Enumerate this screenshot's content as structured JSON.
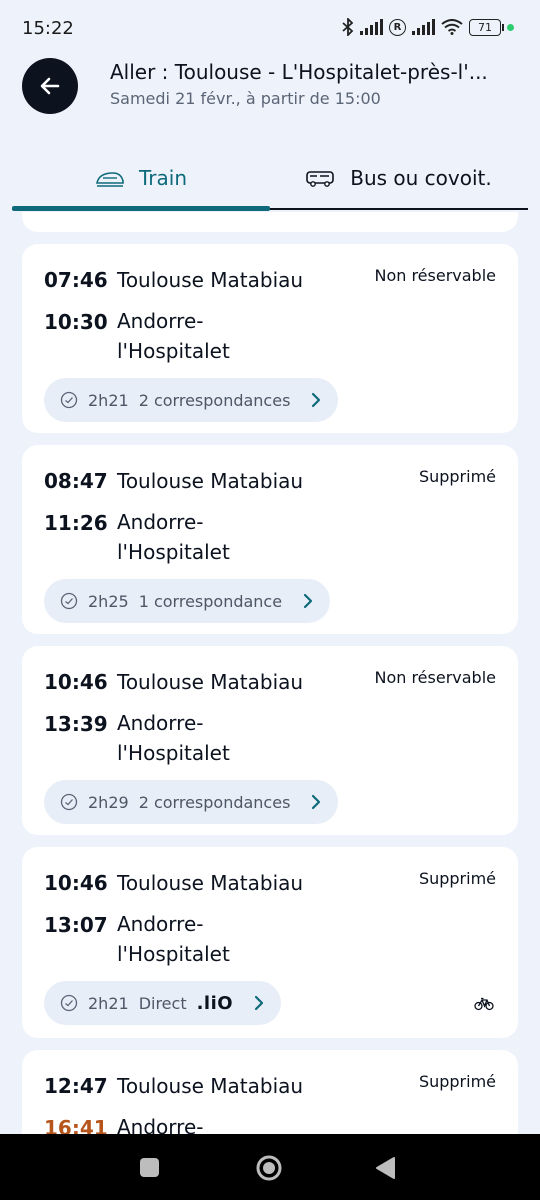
{
  "status_bar": {
    "time": "15:22",
    "battery": "71"
  },
  "header": {
    "title": "Aller : Toulouse - L'Hospitalet-près-l'...",
    "subtitle": "Samedi 21 févr., à partir de 15:00"
  },
  "tabs": [
    {
      "label": "Train",
      "icon": "train-icon",
      "selected": true
    },
    {
      "label": "Bus ou covoit.",
      "icon": "bus-icon",
      "selected": false
    }
  ],
  "colors": {
    "accent": "#0e6a7a",
    "delay": "#b5541b",
    "background": "#eef3fb"
  },
  "journeys": [
    {
      "dep_time": "07:46",
      "dep_station": "Toulouse Matabiau",
      "arr_time": "10:30",
      "arr_station": "Andorre-\nl'Hospitalet",
      "status": "Non réservable",
      "duration": "2h21",
      "connections": "2 correspondances"
    },
    {
      "dep_time": "08:47",
      "dep_station": "Toulouse Matabiau",
      "arr_time": "11:26",
      "arr_station": "Andorre-\nl'Hospitalet",
      "status": "Supprimé",
      "duration": "2h25",
      "connections": "1 correspondance"
    },
    {
      "dep_time": "10:46",
      "dep_station": "Toulouse Matabiau",
      "arr_time": "13:39",
      "arr_station": "Andorre-\nl'Hospitalet",
      "status": "Non réservable",
      "duration": "2h29",
      "connections": "2 correspondances"
    },
    {
      "dep_time": "10:46",
      "dep_station": "Toulouse Matabiau",
      "arr_time": "13:07",
      "arr_station": "Andorre-\nl'Hospitalet",
      "status": "Supprimé",
      "duration": "2h21",
      "connections": "Direct",
      "operator": ".liO",
      "bike": true
    },
    {
      "dep_time": "12:47",
      "dep_station": "Toulouse Matabiau",
      "arr_time": "16:41",
      "arr_station": "Andorre-",
      "status": "Supprimé"
    }
  ]
}
